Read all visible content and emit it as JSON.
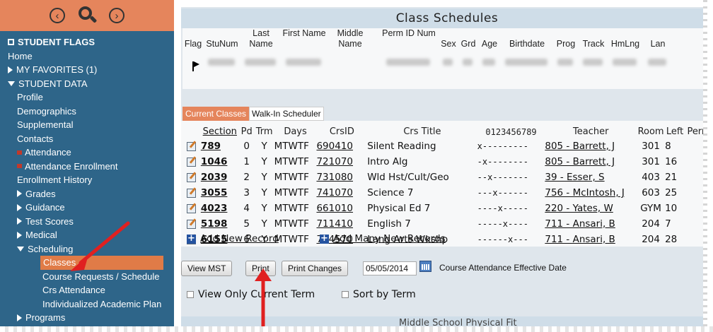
{
  "sidebar": {
    "flags_label": "STUDENT FLAGS",
    "items": [
      {
        "label": "Home",
        "level": 0,
        "kind": "plain"
      },
      {
        "label": "MY FAVORITES (1)",
        "level": 0,
        "kind": "collapsed"
      },
      {
        "label": "STUDENT DATA",
        "level": 0,
        "kind": "expanded"
      },
      {
        "label": "Profile",
        "level": 1,
        "kind": "plain"
      },
      {
        "label": "Demographics",
        "level": 1,
        "kind": "plain"
      },
      {
        "label": "Supplemental",
        "level": 1,
        "kind": "plain"
      },
      {
        "label": "Contacts",
        "level": 1,
        "kind": "plain"
      },
      {
        "label": "Attendance",
        "level": 1,
        "kind": "flag"
      },
      {
        "label": "Attendance Enrollment",
        "level": 1,
        "kind": "flag"
      },
      {
        "label": "Enrollment History",
        "level": 1,
        "kind": "plain"
      },
      {
        "label": "Grades",
        "level": 1,
        "kind": "collapsed"
      },
      {
        "label": "Guidance",
        "level": 1,
        "kind": "collapsed"
      },
      {
        "label": "Test Scores",
        "level": 1,
        "kind": "collapsed"
      },
      {
        "label": "Medical",
        "level": 1,
        "kind": "collapsed"
      },
      {
        "label": "Scheduling",
        "level": 1,
        "kind": "expanded"
      },
      {
        "label": "Classes",
        "level": 2,
        "kind": "active"
      },
      {
        "label": "Course Requests / Schedule",
        "level": 2,
        "kind": "plain"
      },
      {
        "label": "Crs Attendance",
        "level": 2,
        "kind": "plain"
      },
      {
        "label": "Individualized Academic Plan",
        "level": 2,
        "kind": "plain"
      },
      {
        "label": "Programs",
        "level": 1,
        "kind": "collapsed"
      }
    ]
  },
  "page_title": "Class Schedules",
  "student_headers": [
    "Flag",
    "StuNum",
    "Last Name",
    "First Name",
    "Middle Name",
    "Perm ID Num",
    "Sex",
    "Grd",
    "Age",
    "Birthdate",
    "Prog",
    "Track",
    "HmLng",
    "Lan"
  ],
  "tabs": [
    "Current Classes",
    "Walk-In Scheduler"
  ],
  "table": {
    "headers": [
      "Section",
      "Pd",
      "Trm",
      "Days",
      "CrsID",
      "Crs Title",
      "0123456789",
      "Teacher",
      "Room",
      "Left",
      "Perm"
    ],
    "rows": [
      {
        "section": "789",
        "pd": "0",
        "trm": "Y",
        "days": "MTWTF",
        "crsid": "690410",
        "title": "Silent Reading",
        "grid": "x---------",
        "teacher": "805 - Barrett, J",
        "room": "301",
        "left": "8"
      },
      {
        "section": "1046",
        "pd": "1",
        "trm": "Y",
        "days": "MTWTF",
        "crsid": "721070",
        "title": "Intro Alg",
        "grid": "-x--------",
        "teacher": "805 - Barrett, J",
        "room": "301",
        "left": "16"
      },
      {
        "section": "2039",
        "pd": "2",
        "trm": "Y",
        "days": "MTWTF",
        "crsid": "731080",
        "title": "Wld Hst/Cult/Geo",
        "grid": "--x-------",
        "teacher": "39 - Esser, S",
        "room": "403",
        "left": "21"
      },
      {
        "section": "3055",
        "pd": "3",
        "trm": "Y",
        "days": "MTWTF",
        "crsid": "741070",
        "title": "Science 7",
        "grid": "---x------",
        "teacher": "756 - McIntosh, J",
        "room": "603",
        "left": "25"
      },
      {
        "section": "4023",
        "pd": "4",
        "trm": "Y",
        "days": "MTWTF",
        "crsid": "661010",
        "title": "Physical Ed 7",
        "grid": "----x-----",
        "teacher": "220 - Yates, W",
        "room": "GYM",
        "left": "10"
      },
      {
        "section": "5198",
        "pd": "5",
        "trm": "Y",
        "days": "MTWTF",
        "crsid": "711410",
        "title": "English 7",
        "grid": "-----x----",
        "teacher": "711 - Ansari, B",
        "room": "204",
        "left": "7"
      },
      {
        "section": "6155",
        "pd": "6",
        "trm": "Y",
        "days": "MTWTF",
        "crsid": "714570",
        "title": "Lang Arts Wkshp",
        "grid": "------x---",
        "teacher": "711 - Ansari, B",
        "room": "204",
        "left": "28"
      }
    ]
  },
  "actions": {
    "add_new": "Add New Record",
    "add_many": "Add Many New Records",
    "view_mst": "View MST",
    "print": "Print",
    "print_changes": "Print Changes",
    "date_value": "05/05/2014",
    "effective_label": "Course Attendance Effective Date",
    "view_only_label": "View Only Current Term",
    "sort_label": "Sort by Term"
  },
  "bottom_text": "Middle School Physical Fit",
  "colors": {
    "accent": "#e5855c",
    "sidebar": "#2e6589",
    "arrow": "#e02020"
  }
}
